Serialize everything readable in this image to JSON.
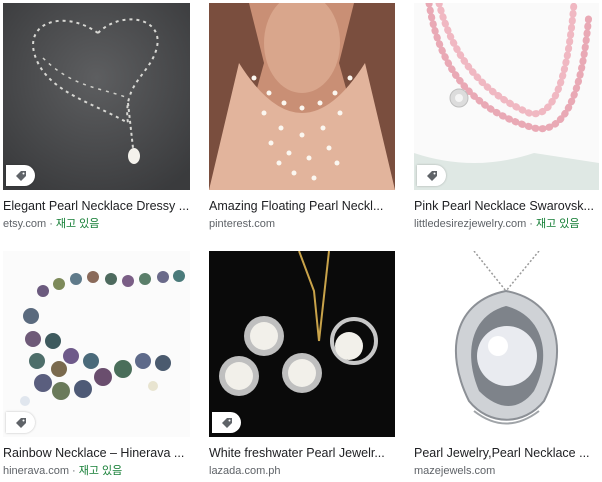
{
  "results": [
    {
      "title": "Elegant Pearl Necklace Dressy ...",
      "source": "etsy.com",
      "stock": "재고 있음",
      "tag_icon": "price-tag-icon"
    },
    {
      "title": "Amazing Floating Pearl Neckl...",
      "source": "pinterest.com",
      "stock": ""
    },
    {
      "title": "Pink Pearl Necklace Swarovsk...",
      "source": "littledesirezjewelry.com",
      "stock": "재고 있음",
      "tag_icon": "price-tag-icon"
    },
    {
      "title": "Rainbow Necklace – Hinerava ...",
      "source": "hinerava.com",
      "stock": "재고 있음",
      "tag_icon": "price-tag-icon"
    },
    {
      "title": "White freshwater Pearl Jewelr...",
      "source": "lazada.com.ph",
      "stock": "",
      "tag_icon": "price-tag-icon"
    },
    {
      "title": "Pearl Jewelry,Pearl Necklace ...",
      "source": "mazejewels.com",
      "stock": ""
    }
  ],
  "colors": {
    "title": "#202124",
    "source": "#5f6368",
    "in_stock": "#188038"
  }
}
